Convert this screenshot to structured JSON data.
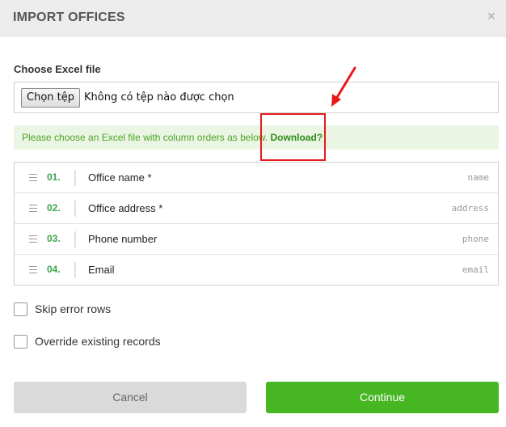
{
  "dialog": {
    "title": "IMPORT OFFICES",
    "close_icon": "×"
  },
  "file": {
    "label": "Choose Excel file",
    "button_label": "Chọn tệp",
    "status": "Không có tệp nào được chọn"
  },
  "alert": {
    "text": "Please choose an Excel file with column orders as below. ",
    "link": "Download?"
  },
  "columns": [
    {
      "number": "01.",
      "name": "Office name *",
      "key": "name"
    },
    {
      "number": "02.",
      "name": "Office address *",
      "key": "address"
    },
    {
      "number": "03.",
      "name": "Phone number",
      "key": "phone"
    },
    {
      "number": "04.",
      "name": "Email",
      "key": "email"
    }
  ],
  "options": {
    "skip_errors": {
      "label": "Skip error rows",
      "checked": false
    },
    "override": {
      "label": "Override existing records",
      "checked": false
    }
  },
  "actions": {
    "cancel_label": "Cancel",
    "continue_label": "Continue"
  },
  "colors": {
    "accent_green": "#46b623",
    "alert_background": "#eaf6e3",
    "annotation_red": "#e8191c"
  }
}
